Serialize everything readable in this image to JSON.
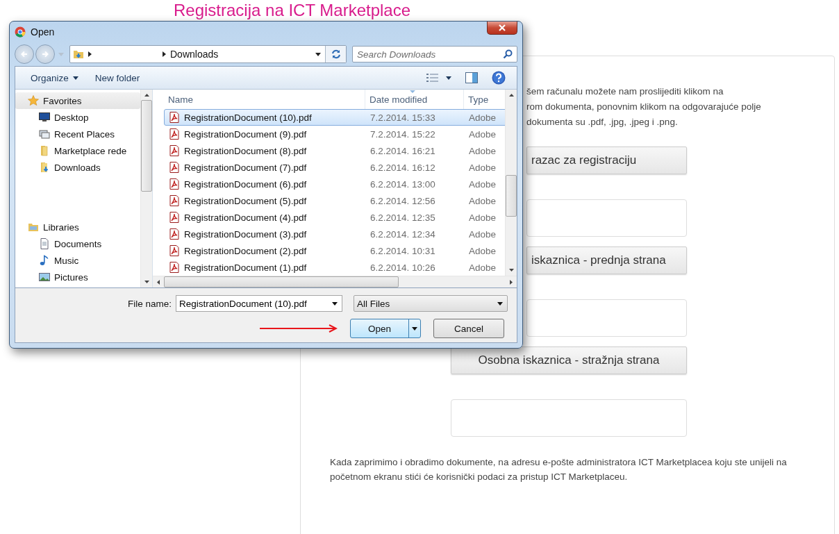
{
  "page": {
    "title": "Registracija na ICT Marketplace",
    "intro_lines": [
      "šem računalu možete nam proslijediti klikom na",
      "rom dokumenta, ponovnim klikom na odgovarajuće polje",
      "dokumenta su .pdf, .jpg, .jpeg i .png."
    ],
    "documents": [
      {
        "button_label": "razac za registraciju",
        "partly_covered": true
      },
      {
        "button_label": "iskaznica - prednja strana",
        "partly_covered": true
      },
      {
        "button_label": "Osobna iskaznica - stražnja strana",
        "partly_covered": false
      }
    ],
    "note": "Kada zaprimimo i obradimo dokumente, na adresu e-pošte administratora ICT Marketplacea koju ste unijeli na početnom ekranu stići će korisnički podaci za pristup ICT Marketplaceu."
  },
  "dialog": {
    "window": {
      "title": "Open"
    },
    "address": {
      "segments": [
        "Downloads"
      ]
    },
    "search": {
      "placeholder": "Search Downloads"
    },
    "toolbar": [
      {
        "label": "Organize",
        "dropdown": true
      },
      {
        "label": "New folder",
        "dropdown": false
      }
    ],
    "navigation": [
      {
        "label": "Favorites",
        "kind": "star",
        "selected": true,
        "children": [
          {
            "label": "Desktop",
            "kind": "desktop"
          },
          {
            "label": "Recent Places",
            "kind": "recent"
          },
          {
            "label": "Marketplace rede",
            "kind": "folder"
          },
          {
            "label": "Downloads",
            "kind": "downloads"
          }
        ]
      },
      {
        "label": "Libraries",
        "kind": "libraries",
        "selected": false,
        "children": [
          {
            "label": "Documents",
            "kind": "documents"
          },
          {
            "label": "Music",
            "kind": "music"
          },
          {
            "label": "Pictures",
            "kind": "pictures"
          }
        ]
      }
    ],
    "columns": [
      "Name",
      "Date modified",
      "Type"
    ],
    "files": [
      {
        "name": "RegistrationDocument (10).pdf",
        "date": "7.2.2014. 15:33",
        "type": "Adobe",
        "selected": true
      },
      {
        "name": "RegistrationDocument (9).pdf",
        "date": "7.2.2014. 15:22",
        "type": "Adobe",
        "selected": false
      },
      {
        "name": "RegistrationDocument (8).pdf",
        "date": "6.2.2014. 16:21",
        "type": "Adobe",
        "selected": false
      },
      {
        "name": "RegistrationDocument (7).pdf",
        "date": "6.2.2014. 16:12",
        "type": "Adobe",
        "selected": false
      },
      {
        "name": "RegistrationDocument (6).pdf",
        "date": "6.2.2014. 13:00",
        "type": "Adobe",
        "selected": false
      },
      {
        "name": "RegistrationDocument (5).pdf",
        "date": "6.2.2014. 12:56",
        "type": "Adobe",
        "selected": false
      },
      {
        "name": "RegistrationDocument (4).pdf",
        "date": "6.2.2014. 12:35",
        "type": "Adobe",
        "selected": false
      },
      {
        "name": "RegistrationDocument (3).pdf",
        "date": "6.2.2014. 12:34",
        "type": "Adobe",
        "selected": false
      },
      {
        "name": "RegistrationDocument (2).pdf",
        "date": "6.2.2014. 10:31",
        "type": "Adobe",
        "selected": false
      },
      {
        "name": "RegistrationDocument (1).pdf",
        "date": "6.2.2014. 10:26",
        "type": "Adobe",
        "selected": false
      }
    ],
    "file_name": {
      "label": "File name:",
      "value": "RegistrationDocument (10).pdf"
    },
    "filter": {
      "value": "All Files"
    },
    "buttons": [
      {
        "label": "Open",
        "default": true
      },
      {
        "label": "Cancel",
        "default": false
      }
    ]
  }
}
